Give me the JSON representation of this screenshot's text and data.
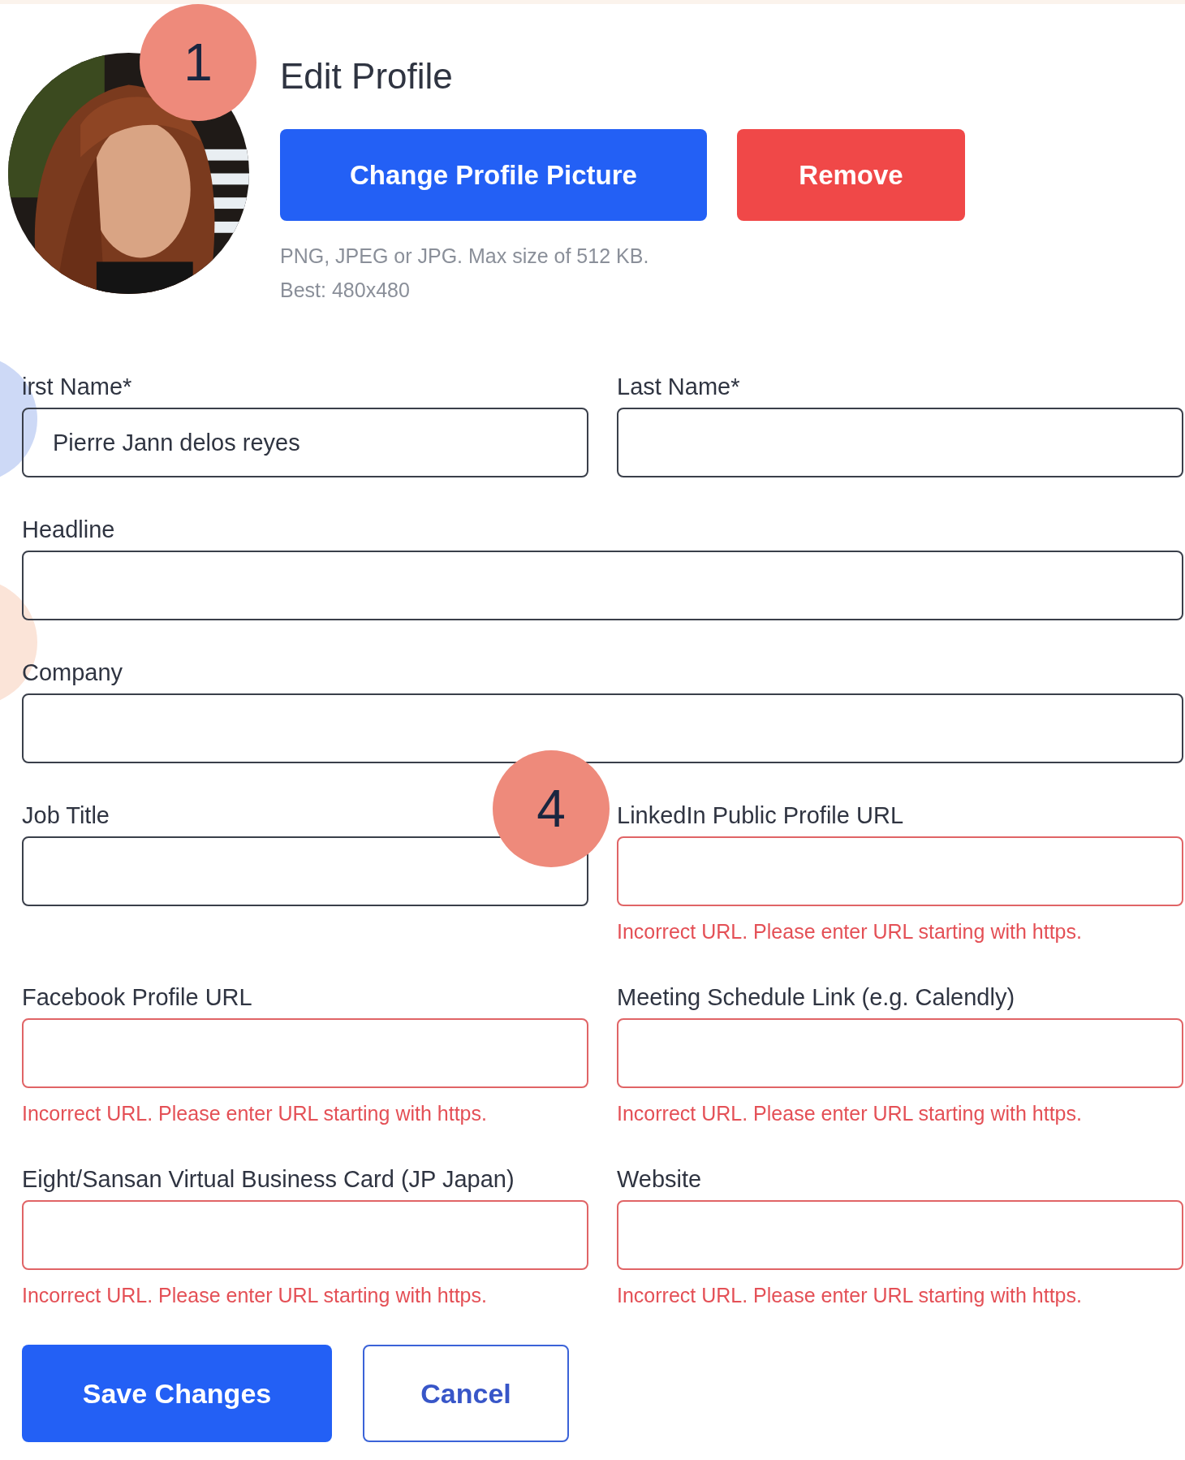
{
  "header": {
    "badge": "1",
    "title": "Edit Profile",
    "buttons": [
      {
        "label": "Change Profile Picture",
        "kind": "primary"
      },
      {
        "label": "Remove",
        "kind": "danger"
      }
    ],
    "hints": [
      "PNG, JPEG or JPG. Max size of 512 KB.",
      "Best: 480x480"
    ]
  },
  "side_markers": [
    {
      "color": "#cdd9f6"
    },
    {
      "color": "#fbe4d8"
    }
  ],
  "rows": [
    {
      "fields": [
        {
          "label": "irst Name*",
          "value": "Pierre Jann delos reyes",
          "invalid": false
        },
        {
          "label": "Last Name*",
          "invalid": false
        }
      ]
    },
    {
      "fields": [
        {
          "label": "Headline",
          "invalid": false
        }
      ]
    },
    {
      "fields": [
        {
          "label": "Company",
          "invalid": false
        }
      ]
    },
    {
      "badge": "4",
      "fields": [
        {
          "label": "Job Title",
          "invalid": false
        },
        {
          "label": "LinkedIn Public Profile URL",
          "invalid": true,
          "error": "Incorrect URL. Please enter URL starting with https."
        }
      ]
    },
    {
      "fields": [
        {
          "label": "Facebook Profile URL",
          "invalid": true,
          "error": "Incorrect URL. Please enter URL starting with https."
        },
        {
          "label": "Meeting Schedule Link (e.g. Calendly)",
          "invalid": true,
          "error": "Incorrect URL. Please enter URL starting with https."
        }
      ]
    },
    {
      "fields": [
        {
          "label": "Eight/Sansan Virtual Business Card (JP Japan)",
          "invalid": true,
          "error": "Incorrect URL. Please enter URL starting with https."
        },
        {
          "label": "Website",
          "invalid": true,
          "error": "Incorrect URL. Please enter URL starting with https."
        }
      ]
    }
  ],
  "actions": [
    {
      "label": "Save Changes",
      "kind": "primary"
    },
    {
      "label": "Cancel",
      "kind": "outline"
    }
  ]
}
